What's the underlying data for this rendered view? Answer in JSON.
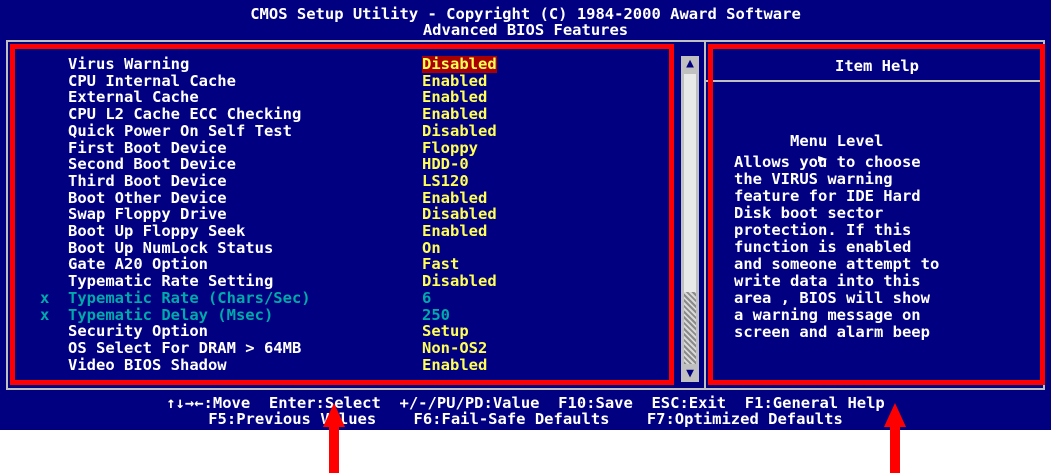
{
  "header": {
    "line1": "CMOS Setup Utility - Copyright (C) 1984-2000 Award Software",
    "line2": "Advanced BIOS Features"
  },
  "settings": [
    {
      "label": "Virus Warning",
      "value": "Disabled",
      "state": "selected"
    },
    {
      "label": "CPU Internal Cache",
      "value": "Enabled"
    },
    {
      "label": "External Cache",
      "value": "Enabled"
    },
    {
      "label": "CPU L2 Cache ECC Checking",
      "value": "Enabled"
    },
    {
      "label": "Quick Power On Self Test",
      "value": "Disabled"
    },
    {
      "label": "First Boot Device",
      "value": "Floppy"
    },
    {
      "label": "Second Boot Device",
      "value": "HDD-0"
    },
    {
      "label": "Third Boot Device",
      "value": "LS120"
    },
    {
      "label": "Boot Other Device",
      "value": "Enabled"
    },
    {
      "label": "Swap Floppy Drive",
      "value": "Disabled"
    },
    {
      "label": "Boot Up Floppy Seek",
      "value": "Enabled"
    },
    {
      "label": "Boot Up NumLock Status",
      "value": "On"
    },
    {
      "label": "Gate A20 Option",
      "value": "Fast"
    },
    {
      "label": "Typematic Rate Setting",
      "value": "Disabled"
    },
    {
      "label": "Typematic Rate (Chars/Sec)",
      "value": "6",
      "state": "disabled",
      "marker": "x"
    },
    {
      "label": "Typematic Delay (Msec)",
      "value": "250",
      "state": "disabled",
      "marker": "x"
    },
    {
      "label": "Security Option",
      "value": "Setup"
    },
    {
      "label": "OS Select For DRAM > 64MB",
      "value": "Non-OS2"
    },
    {
      "label": "Video BIOS Shadow",
      "value": "Enabled"
    }
  ],
  "scrollbar": {
    "up_icon": "up-arrow",
    "down_icon": "down-arrow"
  },
  "help": {
    "title": "Item Help",
    "menu_level": "Menu Level",
    "menu_level_icon": "right-triangle",
    "text": "Allows you to choose\nthe VIRUS warning\nfeature for IDE Hard\nDisk boot sector\nprotection. If this\nfunction is enabled\nand someone attempt to\nwrite data into this\narea ,  BIOS will show\na warning message on\nscreen and alarm beep"
  },
  "footer": {
    "line1": "↑↓→←:Move  Enter:Select  +/-/PU/PD:Value  F10:Save  ESC:Exit  F1:General Help",
    "line2": "F5:Previous Values    F6:Fail-Safe Defaults    F7:Optimized Defaults"
  },
  "colors": {
    "background": "#000080",
    "value_text": "#ffff55",
    "disabled_text": "#00aaaa",
    "selected_highlight": "#aa0000",
    "annotation": "#ff0000"
  }
}
